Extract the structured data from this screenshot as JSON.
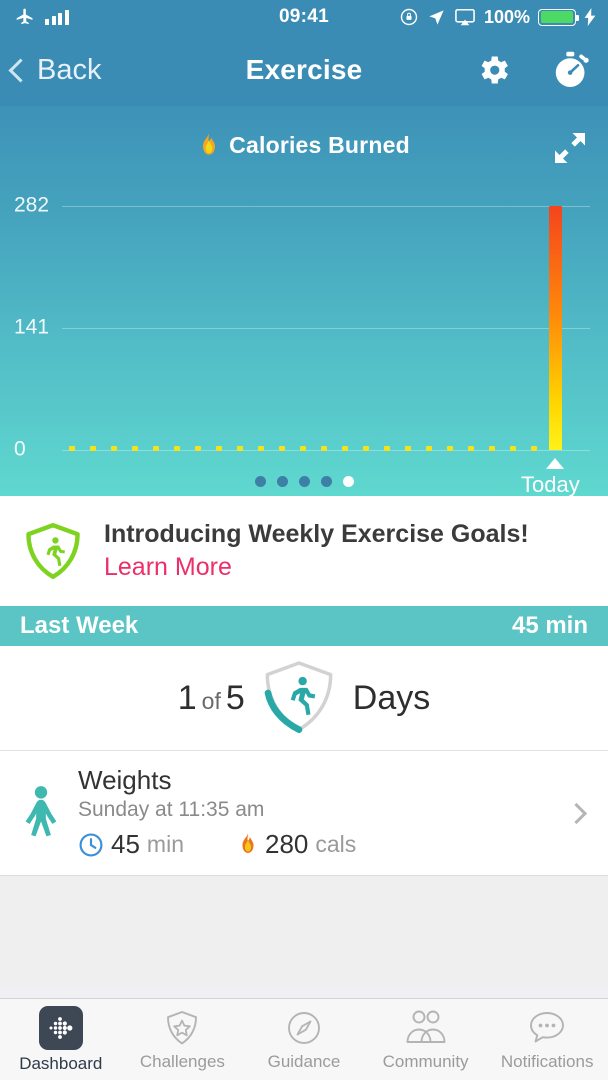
{
  "status_bar": {
    "airplane_icon": "airplane-icon",
    "signal_icon": "signal-bars-icon",
    "time": "09:41",
    "rotation_lock_icon": "rotation-lock-icon",
    "location_icon": "location-arrow-icon",
    "airplay_icon": "airplay-icon",
    "battery_percent": "100%",
    "battery_icon": "battery-icon",
    "charging_icon": "lightning-bolt-icon"
  },
  "nav": {
    "back_label": "Back",
    "title": "Exercise",
    "settings_icon": "gear-icon",
    "stopwatch_icon": "stopwatch-icon"
  },
  "chart_card": {
    "title": "Calories Burned",
    "flame_icon": "flame-icon",
    "expand_icon": "expand-arrows-icon",
    "today_label": "Today",
    "pager": {
      "count": 5,
      "active_index": 4
    }
  },
  "chart_data": {
    "type": "bar",
    "title": "Calories Burned",
    "xlabel": "",
    "ylabel": "",
    "ylim": [
      0,
      282
    ],
    "ytick_labels": [
      "282",
      "141",
      "0"
    ],
    "ytick_values": [
      282,
      141,
      0
    ],
    "grid": true,
    "legend": "none",
    "bar_gradient": [
      "#F4441E",
      "#FF8A0A",
      "#FFD800",
      "#FFF21A"
    ],
    "categories": [
      "",
      "",
      "",
      "",
      "",
      "",
      "",
      "",
      "",
      "",
      "",
      "",
      "",
      "",
      "",
      "",
      "",
      "",
      "",
      "",
      "",
      "",
      "",
      "Today"
    ],
    "values": [
      0,
      0,
      0,
      0,
      0,
      0,
      0,
      0,
      0,
      0,
      0,
      0,
      0,
      0,
      0,
      0,
      0,
      0,
      0,
      0,
      0,
      0,
      0,
      282
    ],
    "annotations": [
      {
        "label": "Today",
        "value": 282,
        "marker": "triangle-up"
      }
    ]
  },
  "promo": {
    "badge_icon": "green-shield-runner-icon",
    "headline": "Introducing Weekly Exercise Goals!",
    "link": "Learn More",
    "link_color": "#EB2F6B",
    "badge_color": "#7ED321"
  },
  "last_week": {
    "header_label": "Last Week",
    "header_value": "45 min",
    "progress_current": "1",
    "progress_of": "of",
    "progress_total": "5",
    "days_label": "Days",
    "shield_icon": "shield-runner-progress-icon",
    "accent_color": "#2AA8A8"
  },
  "activity": {
    "type_icon": "person-arms-up-icon",
    "title": "Weights",
    "subtitle": "Sunday at 11:35 am",
    "duration_icon": "clock-icon",
    "duration_value": "45",
    "duration_unit": "min",
    "calories_icon": "flame-icon",
    "calories_value": "280",
    "calories_unit": "cals",
    "chevron_icon": "chevron-right-icon"
  },
  "tabbar": {
    "tabs": [
      {
        "label": "Dashboard",
        "icon": "fitbit-logo-icon",
        "active": true
      },
      {
        "label": "Challenges",
        "icon": "shield-star-icon",
        "active": false
      },
      {
        "label": "Guidance",
        "icon": "compass-icon",
        "active": false
      },
      {
        "label": "Community",
        "icon": "people-icon",
        "active": false
      },
      {
        "label": "Notifications",
        "icon": "speech-bubble-icon",
        "active": false
      }
    ]
  }
}
